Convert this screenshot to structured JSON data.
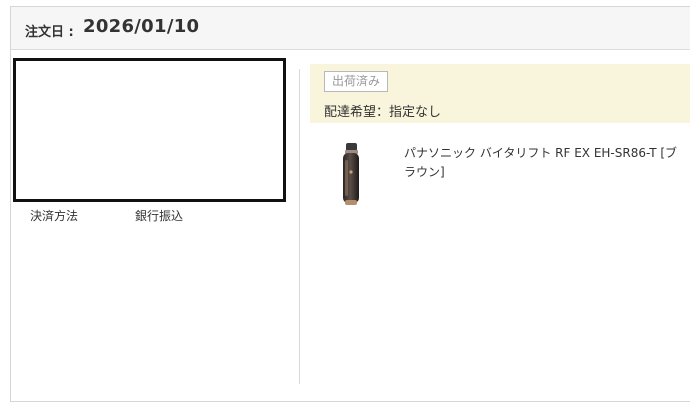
{
  "order": {
    "date_label": "注文日 :",
    "date_value": "2026/01/10"
  },
  "payment": {
    "label": "決済方法",
    "value": "銀行振込"
  },
  "shipment": {
    "status_badge": "出荷済み",
    "delivery_preference": "配達希望：指定なし"
  },
  "product": {
    "name": "パナソニック バイタリフト RF EX EH-SR86-T [ブラウン]",
    "thumbnail_icon": "face-care-device-icon"
  },
  "colors": {
    "status_bg": "#f8f5dc",
    "header_bg": "#f6f6f6"
  }
}
